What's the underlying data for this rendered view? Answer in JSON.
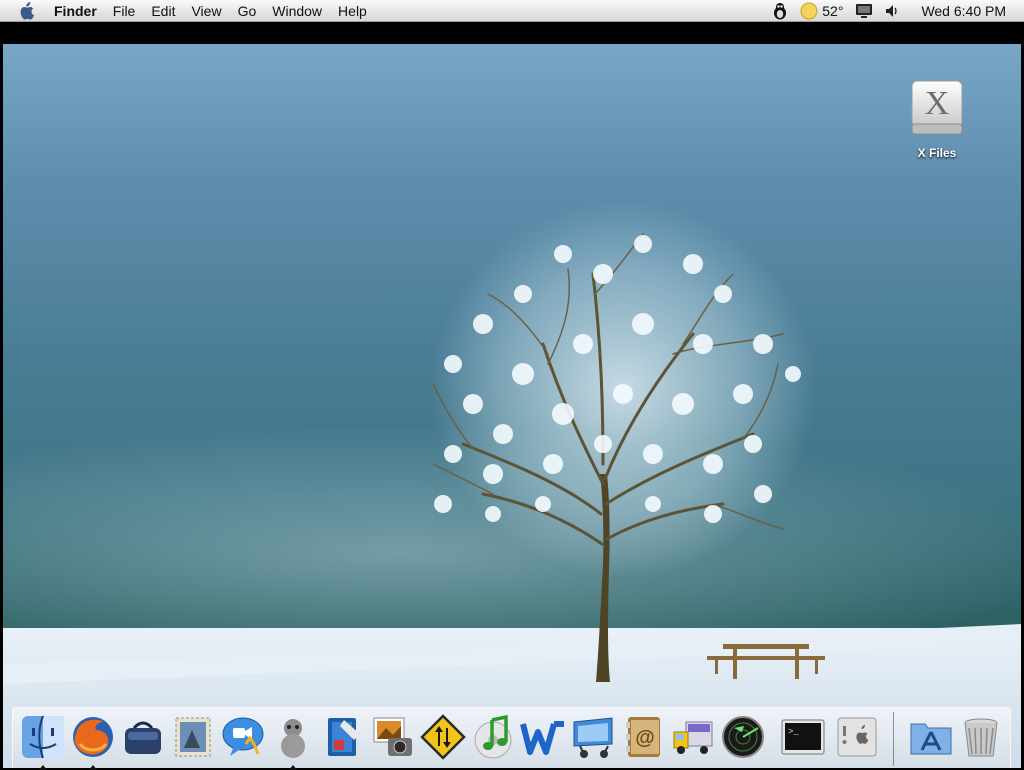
{
  "menubar": {
    "app_name": "Finder",
    "menus": [
      "File",
      "Edit",
      "View",
      "Go",
      "Window",
      "Help"
    ],
    "temperature": "52°",
    "clock": "Wed 6:40 PM"
  },
  "desktop": {
    "icons": [
      {
        "label": "X Files",
        "glyph": "X"
      }
    ]
  },
  "dock": {
    "items": [
      {
        "name": "finder",
        "running": true
      },
      {
        "name": "firefox",
        "running": true
      },
      {
        "name": "ichat-bag"
      },
      {
        "name": "mail-stamp"
      },
      {
        "name": "ichat"
      },
      {
        "name": "adium",
        "running": true
      },
      {
        "name": "dashboard-book"
      },
      {
        "name": "iphoto"
      },
      {
        "name": "transmit-sign"
      },
      {
        "name": "itunes"
      },
      {
        "name": "word"
      },
      {
        "name": "automator"
      },
      {
        "name": "address-book"
      },
      {
        "name": "delivery-truck"
      },
      {
        "name": "network-radar"
      },
      {
        "name": "terminal",
        "terminal_prompt": ">_"
      },
      {
        "name": "system-profiler"
      },
      {
        "name": "applications-folder"
      },
      {
        "name": "trash"
      }
    ]
  }
}
